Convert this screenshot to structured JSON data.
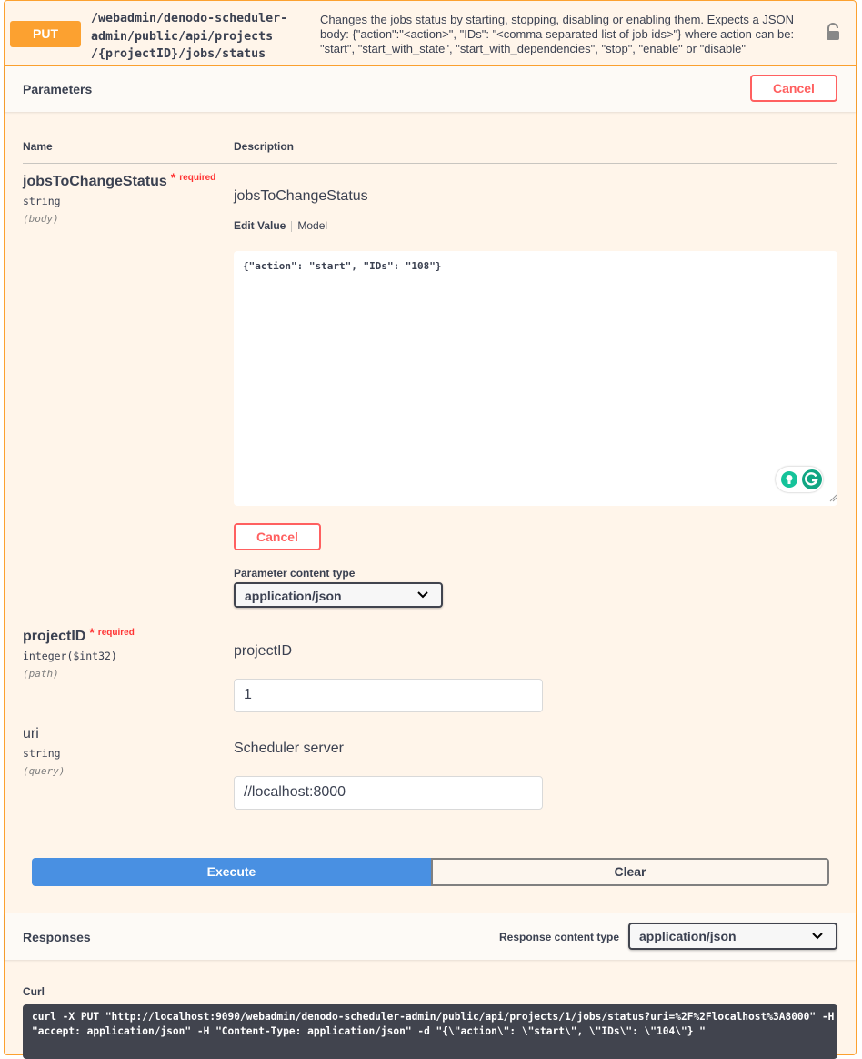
{
  "operation": {
    "method": "PUT",
    "path_lines": [
      "/webadmin/denodo-scheduler-",
      "admin/public/api/projects",
      "/{projectID}/jobs/status"
    ],
    "description_lines": [
      "Changes the jobs status by starting, stopping, disabling or enabling them. Expects a JSON",
      "body: {\"action\":\"<action>\", \"IDs\": \"<comma separated list of job ids>\"} where action can be:",
      "\"start\", \"start_with_state\", \"start_with_dependencies\", \"stop\", \"enable\" or \"disable\""
    ],
    "lock_icon": "lock-icon"
  },
  "parameters": {
    "title": "Parameters",
    "cancel_label": "Cancel",
    "col_name": "Name",
    "col_description": "Description",
    "items": [
      {
        "name": "jobsToChangeStatus",
        "star": "*",
        "required": "required",
        "type": "string",
        "in": "(body)",
        "description": "jobsToChangeStatus",
        "tab_edit": "Edit Value",
        "tab_model": "Model",
        "value": "{\"action\": \"start\", \"IDs\": \"108\"}",
        "cancel_label": "Cancel",
        "content_type_label": "Parameter content type",
        "content_type": "application/json"
      },
      {
        "name": "projectID",
        "star": "*",
        "required": "required",
        "type": "integer($int32)",
        "in": "(path)",
        "description": "projectID",
        "value": "1"
      },
      {
        "name": "uri",
        "type": "string",
        "in": "(query)",
        "description": "Scheduler server",
        "value": "//localhost:8000"
      }
    ]
  },
  "actions": {
    "execute": "Execute",
    "clear": "Clear"
  },
  "responses": {
    "title": "Responses",
    "content_type_label": "Response content type",
    "content_type": "application/json",
    "curl_label": "Curl",
    "curl_lines": [
      "curl -X PUT \"http://localhost:9090/webadmin/denodo-scheduler-admin/public/api/projects/1/jobs/status?uri=%2F%2Flocalhost%3A8000\" -H",
      "\"accept: application/json\" -H \"Content-Type: application/json\" -d \"{\\\"action\\\": \\\"start\\\", \\\"IDs\\\": \\\"104\\\"} \""
    ]
  },
  "colors": {
    "put": "#fca130",
    "execute": "#4990e2",
    "cancel": "#ff6060",
    "required": "#ff3333"
  }
}
